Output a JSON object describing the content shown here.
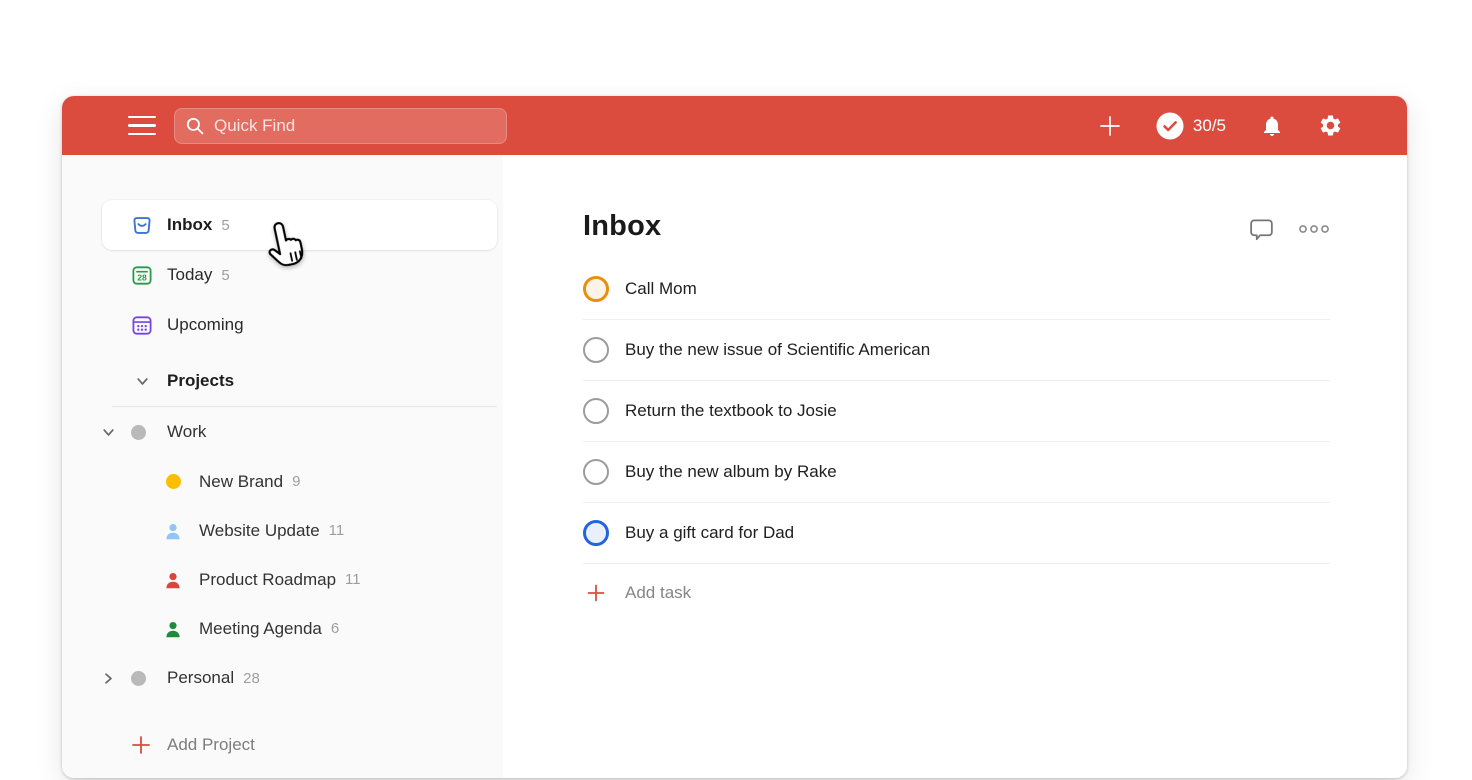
{
  "topbar": {
    "search": {
      "placeholder": "Quick Find"
    },
    "completed_counter": "30/5"
  },
  "sidebar": {
    "nav": [
      {
        "label": "Inbox",
        "count": "5"
      },
      {
        "label": "Today",
        "count": "5"
      },
      {
        "label": "Upcoming",
        "count": ""
      }
    ],
    "projects_header": "Projects",
    "projects": [
      {
        "label": "Work",
        "count": ""
      },
      {
        "label": "New Brand",
        "count": "9"
      },
      {
        "label": "Website Update",
        "count": "11"
      },
      {
        "label": "Product Roadmap",
        "count": "11"
      },
      {
        "label": "Meeting Agenda",
        "count": "6"
      },
      {
        "label": "Personal",
        "count": "28"
      }
    ],
    "add_project": "Add Project",
    "today_icon_date": "28"
  },
  "main": {
    "title": "Inbox",
    "tasks": [
      {
        "label": "Call Mom"
      },
      {
        "label": "Buy the new issue of Scientific American"
      },
      {
        "label": "Return the textbook to Josie"
      },
      {
        "label": "Buy the new album by Rake"
      },
      {
        "label": "Buy a gift card for Dad"
      }
    ],
    "add_task": "Add task"
  },
  "colors": {
    "topbar_red": "#dc4c3e",
    "priority_orange": "#e98f0e",
    "priority_blue": "#2264e0",
    "inbox_blue": "#3f74d4",
    "today_green": "#2a9a47",
    "upcoming_purple": "#7445e0",
    "new_brand_yellow": "#fcbe02",
    "website_blue": "#92c5f5",
    "roadmap_red": "#d6473c",
    "agenda_green": "#1f8a3d"
  }
}
